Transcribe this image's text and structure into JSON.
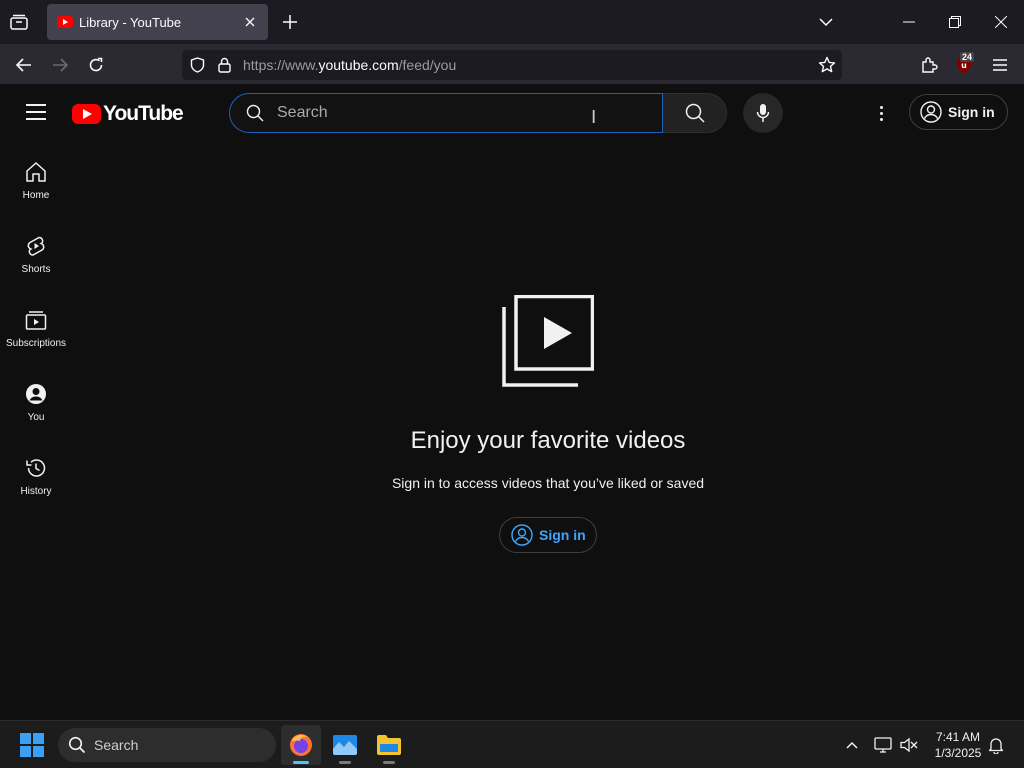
{
  "browser": {
    "tab": {
      "title": "Library - YouTube"
    },
    "url": {
      "prefix": "https://www.",
      "host": "youtube.com",
      "path": "/feed/you"
    },
    "extension_badge": "24"
  },
  "youtube": {
    "logo_text": "YouTube",
    "search": {
      "placeholder": "Search"
    },
    "signin_label": "Sign in",
    "sidebar": [
      {
        "label": "Home",
        "icon": "home-icon"
      },
      {
        "label": "Shorts",
        "icon": "shorts-icon"
      },
      {
        "label": "Subscriptions",
        "icon": "subscriptions-icon"
      },
      {
        "label": "You",
        "icon": "you-icon"
      },
      {
        "label": "History",
        "icon": "history-icon"
      }
    ],
    "empty_state": {
      "title": "Enjoy your favorite videos",
      "subtitle": "Sign in to access videos that you’ve liked or saved",
      "button_label": "Sign in"
    }
  },
  "taskbar": {
    "search_label": "Search",
    "time": "7:41 AM",
    "date": "1/3/2025"
  },
  "colors": {
    "background": "#0f0f0f",
    "accent_blue": "#3ea6ff",
    "youtube_red": "#ff0000",
    "search_focus_border": "#1c62b9"
  }
}
